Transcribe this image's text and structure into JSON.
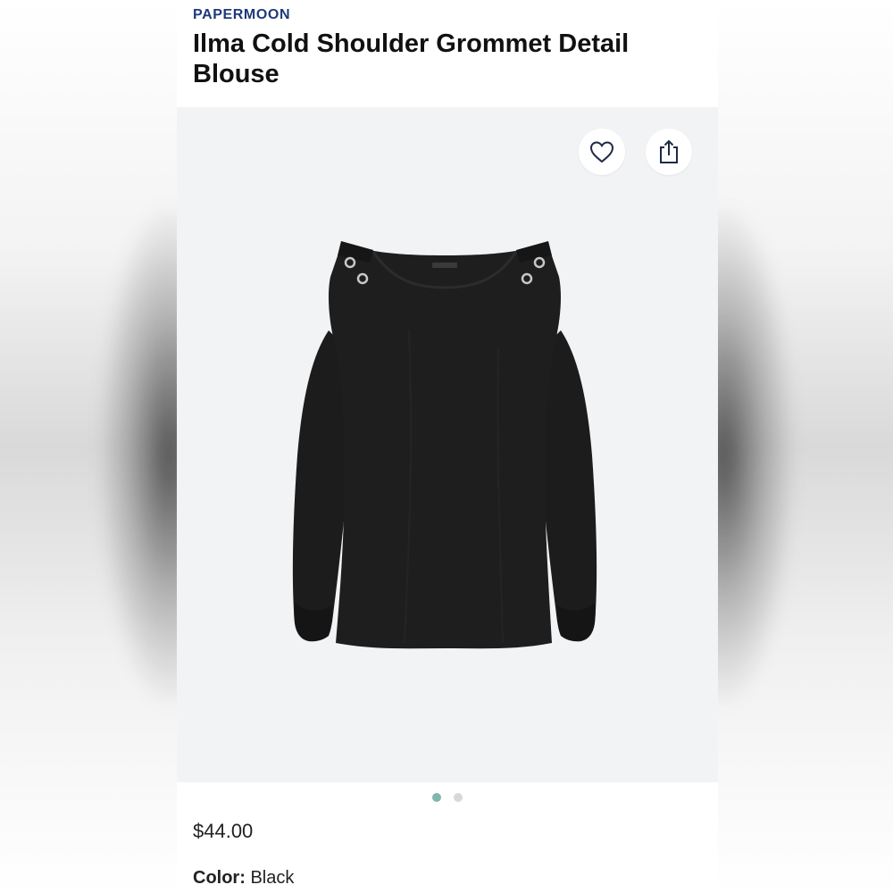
{
  "product": {
    "brand": "PAPERMOON",
    "name": "Ilma Cold Shoulder Grommet Detail Blouse",
    "price": "$44.00",
    "color_label": "Color:",
    "color_value": "Black"
  },
  "gallery": {
    "image_subject": "black cold shoulder blouse",
    "current_index": 1,
    "total_images": 2,
    "active_dot_color": "#7fb7ad",
    "inactive_dot_color": "#d6d8dc"
  },
  "actions": {
    "favorite_icon": "heart-icon",
    "share_icon": "share-icon"
  },
  "theme": {
    "brand_color": "#1e3a78",
    "image_background": "#f2f3f5"
  }
}
